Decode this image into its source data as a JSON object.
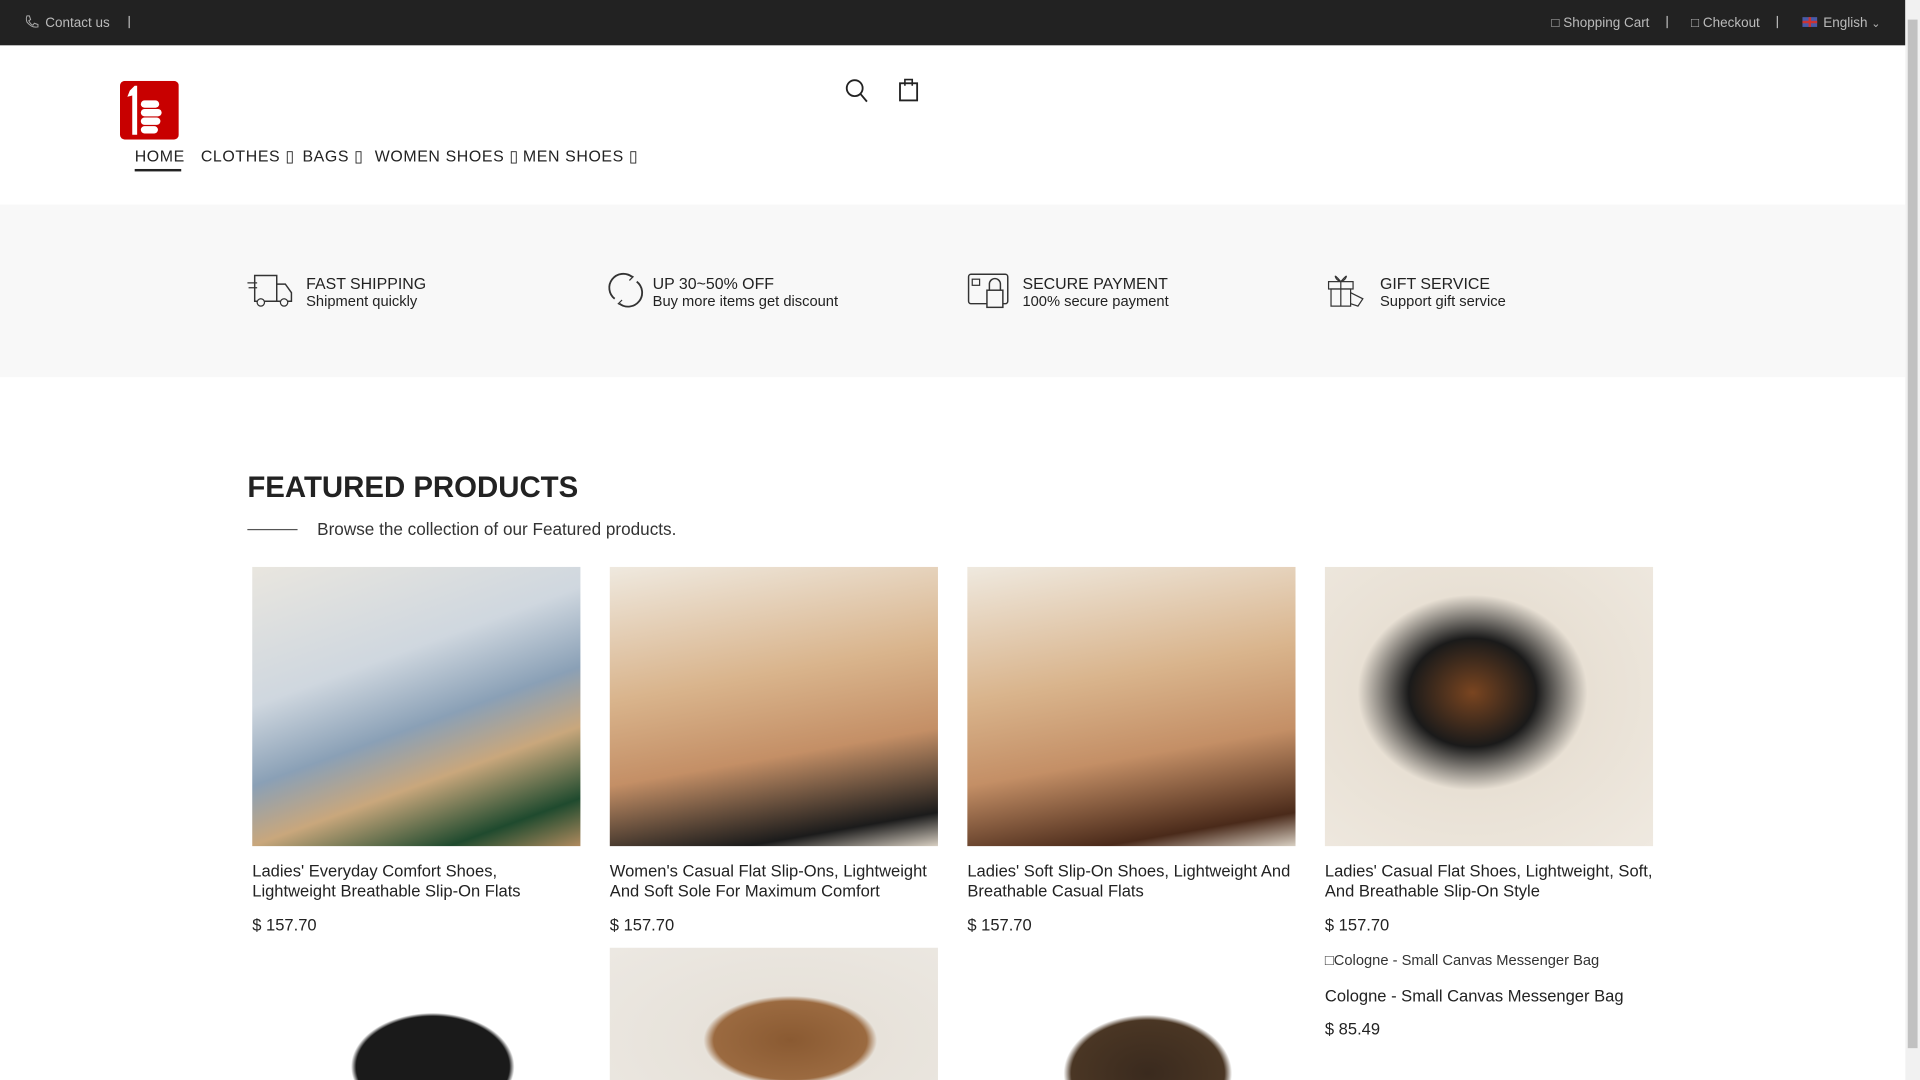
{
  "topbar": {
    "contact": "Contact us",
    "cart": "□ Shopping Cart",
    "checkout": "□ Checkout",
    "language": "English"
  },
  "header": {
    "icons": [
      "search-icon",
      "shopping-bag-icon"
    ]
  },
  "nav": [
    {
      "label": "HOME"
    },
    {
      "label": "CLOTHES ▯"
    },
    {
      "label": "BAGS ▯"
    },
    {
      "label": "WOMEN SHOES ▯"
    },
    {
      "label": "MEN SHOES ▯"
    }
  ],
  "features": [
    {
      "title": "FAST SHIPPING",
      "subtitle": "Shipment quickly",
      "icon": "truck-icon"
    },
    {
      "title": "UP 30~50% OFF",
      "subtitle": "Buy more items get discount",
      "icon": "refresh-icon"
    },
    {
      "title": "SECURE PAYMENT",
      "subtitle": "100% secure payment",
      "icon": "lock-card-icon"
    },
    {
      "title": "GIFT SERVICE",
      "subtitle": "Support gift service",
      "icon": "gift-icon"
    }
  ],
  "featured": {
    "title": "FEATURED PRODUCTS",
    "subtitle": "Browse the collection of our Featured products."
  },
  "products": [
    {
      "title": "Ladies' Everyday Comfort Shoes, Lightweight Breathable Slip-On Flats",
      "price": "$ 157.70"
    },
    {
      "title": "Women's Casual Flat Slip-Ons, Lightweight And Soft Sole For Maximum Comfort",
      "price": "$ 157.70"
    },
    {
      "title": "Ladies' Soft Slip-On Shoes, Lightweight And Breathable Casual Flats",
      "price": "$ 157.70"
    },
    {
      "title": "Ladies' Casual Flat Shoes, Lightweight, Soft, And Breathable Slip-On Style",
      "price": "$ 157.70"
    },
    {
      "title": "Cologne - Small Canvas Messenger Bag",
      "price": "$ 85.49",
      "alt": "Cologne - Small Canvas Messenger Bag"
    }
  ]
}
